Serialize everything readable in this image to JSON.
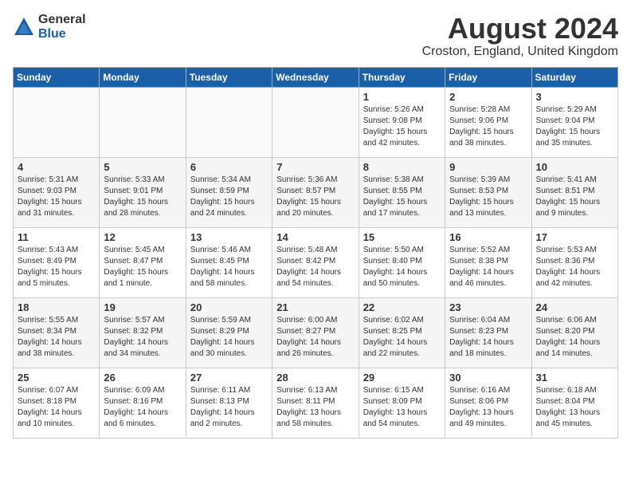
{
  "header": {
    "logo_general": "General",
    "logo_blue": "Blue",
    "month_year": "August 2024",
    "location": "Croston, England, United Kingdom"
  },
  "weekdays": [
    "Sunday",
    "Monday",
    "Tuesday",
    "Wednesday",
    "Thursday",
    "Friday",
    "Saturday"
  ],
  "weeks": [
    [
      {
        "day": "",
        "sunrise": "",
        "sunset": "",
        "daylight": "",
        "empty": true
      },
      {
        "day": "",
        "sunrise": "",
        "sunset": "",
        "daylight": "",
        "empty": true
      },
      {
        "day": "",
        "sunrise": "",
        "sunset": "",
        "daylight": "",
        "empty": true
      },
      {
        "day": "",
        "sunrise": "",
        "sunset": "",
        "daylight": "",
        "empty": true
      },
      {
        "day": "1",
        "sunrise": "Sunrise: 5:26 AM",
        "sunset": "Sunset: 9:08 PM",
        "daylight": "Daylight: 15 hours and 42 minutes.",
        "empty": false
      },
      {
        "day": "2",
        "sunrise": "Sunrise: 5:28 AM",
        "sunset": "Sunset: 9:06 PM",
        "daylight": "Daylight: 15 hours and 38 minutes.",
        "empty": false
      },
      {
        "day": "3",
        "sunrise": "Sunrise: 5:29 AM",
        "sunset": "Sunset: 9:04 PM",
        "daylight": "Daylight: 15 hours and 35 minutes.",
        "empty": false
      }
    ],
    [
      {
        "day": "4",
        "sunrise": "Sunrise: 5:31 AM",
        "sunset": "Sunset: 9:03 PM",
        "daylight": "Daylight: 15 hours and 31 minutes.",
        "empty": false
      },
      {
        "day": "5",
        "sunrise": "Sunrise: 5:33 AM",
        "sunset": "Sunset: 9:01 PM",
        "daylight": "Daylight: 15 hours and 28 minutes.",
        "empty": false
      },
      {
        "day": "6",
        "sunrise": "Sunrise: 5:34 AM",
        "sunset": "Sunset: 8:59 PM",
        "daylight": "Daylight: 15 hours and 24 minutes.",
        "empty": false
      },
      {
        "day": "7",
        "sunrise": "Sunrise: 5:36 AM",
        "sunset": "Sunset: 8:57 PM",
        "daylight": "Daylight: 15 hours and 20 minutes.",
        "empty": false
      },
      {
        "day": "8",
        "sunrise": "Sunrise: 5:38 AM",
        "sunset": "Sunset: 8:55 PM",
        "daylight": "Daylight: 15 hours and 17 minutes.",
        "empty": false
      },
      {
        "day": "9",
        "sunrise": "Sunrise: 5:39 AM",
        "sunset": "Sunset: 8:53 PM",
        "daylight": "Daylight: 15 hours and 13 minutes.",
        "empty": false
      },
      {
        "day": "10",
        "sunrise": "Sunrise: 5:41 AM",
        "sunset": "Sunset: 8:51 PM",
        "daylight": "Daylight: 15 hours and 9 minutes.",
        "empty": false
      }
    ],
    [
      {
        "day": "11",
        "sunrise": "Sunrise: 5:43 AM",
        "sunset": "Sunset: 8:49 PM",
        "daylight": "Daylight: 15 hours and 5 minutes.",
        "empty": false
      },
      {
        "day": "12",
        "sunrise": "Sunrise: 5:45 AM",
        "sunset": "Sunset: 8:47 PM",
        "daylight": "Daylight: 15 hours and 1 minute.",
        "empty": false
      },
      {
        "day": "13",
        "sunrise": "Sunrise: 5:46 AM",
        "sunset": "Sunset: 8:45 PM",
        "daylight": "Daylight: 14 hours and 58 minutes.",
        "empty": false
      },
      {
        "day": "14",
        "sunrise": "Sunrise: 5:48 AM",
        "sunset": "Sunset: 8:42 PM",
        "daylight": "Daylight: 14 hours and 54 minutes.",
        "empty": false
      },
      {
        "day": "15",
        "sunrise": "Sunrise: 5:50 AM",
        "sunset": "Sunset: 8:40 PM",
        "daylight": "Daylight: 14 hours and 50 minutes.",
        "empty": false
      },
      {
        "day": "16",
        "sunrise": "Sunrise: 5:52 AM",
        "sunset": "Sunset: 8:38 PM",
        "daylight": "Daylight: 14 hours and 46 minutes.",
        "empty": false
      },
      {
        "day": "17",
        "sunrise": "Sunrise: 5:53 AM",
        "sunset": "Sunset: 8:36 PM",
        "daylight": "Daylight: 14 hours and 42 minutes.",
        "empty": false
      }
    ],
    [
      {
        "day": "18",
        "sunrise": "Sunrise: 5:55 AM",
        "sunset": "Sunset: 8:34 PM",
        "daylight": "Daylight: 14 hours and 38 minutes.",
        "empty": false
      },
      {
        "day": "19",
        "sunrise": "Sunrise: 5:57 AM",
        "sunset": "Sunset: 8:32 PM",
        "daylight": "Daylight: 14 hours and 34 minutes.",
        "empty": false
      },
      {
        "day": "20",
        "sunrise": "Sunrise: 5:59 AM",
        "sunset": "Sunset: 8:29 PM",
        "daylight": "Daylight: 14 hours and 30 minutes.",
        "empty": false
      },
      {
        "day": "21",
        "sunrise": "Sunrise: 6:00 AM",
        "sunset": "Sunset: 8:27 PM",
        "daylight": "Daylight: 14 hours and 26 minutes.",
        "empty": false
      },
      {
        "day": "22",
        "sunrise": "Sunrise: 6:02 AM",
        "sunset": "Sunset: 8:25 PM",
        "daylight": "Daylight: 14 hours and 22 minutes.",
        "empty": false
      },
      {
        "day": "23",
        "sunrise": "Sunrise: 6:04 AM",
        "sunset": "Sunset: 8:23 PM",
        "daylight": "Daylight: 14 hours and 18 minutes.",
        "empty": false
      },
      {
        "day": "24",
        "sunrise": "Sunrise: 6:06 AM",
        "sunset": "Sunset: 8:20 PM",
        "daylight": "Daylight: 14 hours and 14 minutes.",
        "empty": false
      }
    ],
    [
      {
        "day": "25",
        "sunrise": "Sunrise: 6:07 AM",
        "sunset": "Sunset: 8:18 PM",
        "daylight": "Daylight: 14 hours and 10 minutes.",
        "empty": false
      },
      {
        "day": "26",
        "sunrise": "Sunrise: 6:09 AM",
        "sunset": "Sunset: 8:16 PM",
        "daylight": "Daylight: 14 hours and 6 minutes.",
        "empty": false
      },
      {
        "day": "27",
        "sunrise": "Sunrise: 6:11 AM",
        "sunset": "Sunset: 8:13 PM",
        "daylight": "Daylight: 14 hours and 2 minutes.",
        "empty": false
      },
      {
        "day": "28",
        "sunrise": "Sunrise: 6:13 AM",
        "sunset": "Sunset: 8:11 PM",
        "daylight": "Daylight: 13 hours and 58 minutes.",
        "empty": false
      },
      {
        "day": "29",
        "sunrise": "Sunrise: 6:15 AM",
        "sunset": "Sunset: 8:09 PM",
        "daylight": "Daylight: 13 hours and 54 minutes.",
        "empty": false
      },
      {
        "day": "30",
        "sunrise": "Sunrise: 6:16 AM",
        "sunset": "Sunset: 8:06 PM",
        "daylight": "Daylight: 13 hours and 49 minutes.",
        "empty": false
      },
      {
        "day": "31",
        "sunrise": "Sunrise: 6:18 AM",
        "sunset": "Sunset: 8:04 PM",
        "daylight": "Daylight: 13 hours and 45 minutes.",
        "empty": false
      }
    ]
  ]
}
